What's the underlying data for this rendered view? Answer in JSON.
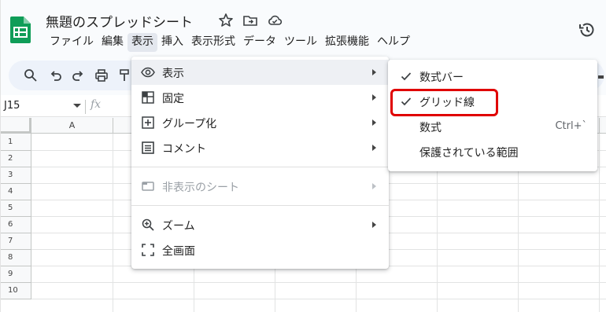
{
  "app": {
    "doc_title": "無題のスプレッドシート",
    "brand_color": "#0f9d58",
    "title_icons": [
      "star-icon",
      "move-to-folder-icon",
      "cloud-status-icon"
    ],
    "history_icon": "version-history-icon"
  },
  "menubar": {
    "items": [
      "ファイル",
      "編集",
      "表示",
      "挿入",
      "表示形式",
      "データ",
      "ツール",
      "拡張機能",
      "ヘルプ"
    ],
    "active": "表示"
  },
  "toolbar": {
    "icons": [
      "search-icon",
      "undo-icon",
      "redo-icon",
      "print-icon",
      "paint-format-icon"
    ]
  },
  "formula_bar": {
    "cell_ref": "J15",
    "fx": "fx"
  },
  "grid": {
    "columns": [
      "A",
      "",
      "",
      "",
      "",
      "",
      "",
      ""
    ],
    "rows": [
      "1",
      "2",
      "3",
      "4",
      "5",
      "6",
      "7",
      "8",
      "9",
      "10"
    ]
  },
  "view_menu": {
    "items": [
      {
        "label": "表示",
        "icon": "eye-icon",
        "submenu": true,
        "highlighted": true
      },
      {
        "label": "固定",
        "icon": "freeze-icon",
        "submenu": true
      },
      {
        "label": "グループ化",
        "icon": "group-icon",
        "submenu": true
      },
      {
        "label": "コメント",
        "icon": "comment-icon",
        "submenu": true
      },
      {
        "label": "非表示のシート",
        "icon": "hidden-sheet-icon",
        "submenu": true,
        "disabled": true
      },
      {
        "label": "ズーム",
        "icon": "zoom-icon",
        "submenu": true
      },
      {
        "label": "全画面",
        "icon": "fullscreen-icon",
        "submenu": false
      }
    ]
  },
  "show_submenu": {
    "items": [
      {
        "label": "数式バー",
        "checked": true
      },
      {
        "label": "グリッド線",
        "checked": true,
        "emphasized": true
      },
      {
        "label": "数式",
        "checked": false,
        "shortcut": "Ctrl+`"
      },
      {
        "label": "保護されている範囲",
        "checked": false
      }
    ]
  },
  "colors": {
    "accent_highlight": "#e00000",
    "toolbar_bg": "#edf2fa",
    "menu_hover": "#eef0f4"
  }
}
